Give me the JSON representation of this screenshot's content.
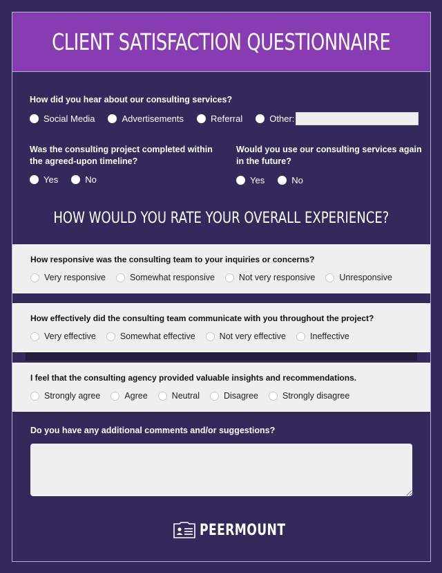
{
  "title": "CLIENT SATISFACTION QUESTIONNAIRE",
  "colors": {
    "background": "#33295a",
    "header": "#873db1",
    "card": "#efefef",
    "border": "#b7aed8"
  },
  "q_source": {
    "label": "How did you hear about our consulting services?",
    "options": [
      "Social Media",
      "Advertisements",
      "Referral",
      "Other:"
    ],
    "other_value": ""
  },
  "q_timeline": {
    "label_line1": "Was the consulting project completed within",
    "label_line2": "the agreed-upon timeline?",
    "options": [
      "Yes",
      "No"
    ]
  },
  "q_reuse": {
    "label_line1": "Would you use our consulting services again",
    "label_line2": "in the future?",
    "options": [
      "Yes",
      "No"
    ]
  },
  "section_title": "HOW WOULD YOU RATE YOUR OVERALL EXPERIENCE?",
  "ratings": [
    {
      "question": "How responsive was the consulting team to your inquiries or concerns?",
      "options": [
        "Very responsive",
        "Somewhat responsive",
        "Not very responsive",
        "Unresponsive"
      ]
    },
    {
      "question": "How effectively did the consulting team communicate with you throughout the project?",
      "options": [
        "Very effective",
        "Somewhat effective",
        "Not very effective",
        "Ineffective"
      ]
    },
    {
      "question": "I feel that the consulting agency provided valuable insights and recommendations.",
      "options": [
        "Strongly agree",
        "Agree",
        "Neutral",
        "Disagree",
        "Strongly disagree"
      ]
    }
  ],
  "comments": {
    "label": "Do you have any additional comments and/or suggestions?",
    "value": ""
  },
  "logo": {
    "icon": "id-card-icon",
    "text": "PEERMOUNT"
  }
}
